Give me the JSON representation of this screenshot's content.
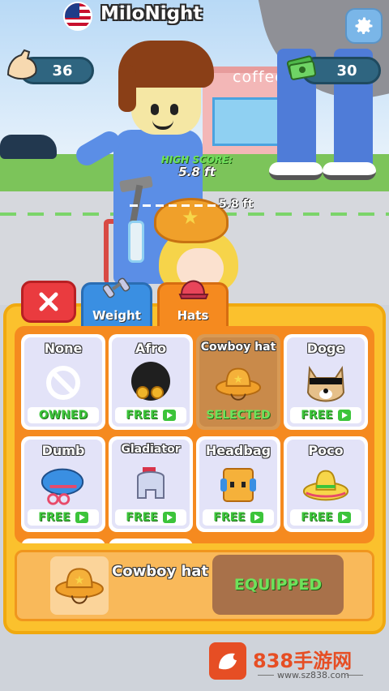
{
  "player": {
    "name": "MiloNight",
    "flag": "us-flag-icon"
  },
  "stats": {
    "strength": "36",
    "cash": "30"
  },
  "scene": {
    "sign": "coffee",
    "high_score_label": "HIGH SCORE:",
    "high_score_value": "5.8 ft",
    "height_marker": "5.8 ft"
  },
  "tabs": [
    {
      "id": "close",
      "icon": "close-icon"
    },
    {
      "id": "weight",
      "label": "Weight",
      "icon": "dumbbell-icon"
    },
    {
      "id": "hats",
      "label": "Hats",
      "icon": "cap-icon",
      "active": true
    }
  ],
  "items": [
    {
      "name": "None",
      "status": "OWNED",
      "icon": "none-icon"
    },
    {
      "name": "Afro",
      "status": "FREE",
      "icon": "afro-icon",
      "ad": true
    },
    {
      "name": "Cowboy hat",
      "status": "SELECTED",
      "icon": "cowboy-hat-icon",
      "selected": true
    },
    {
      "name": "Doge",
      "status": "FREE",
      "icon": "doge-icon",
      "ad": true
    },
    {
      "name": "Dumb",
      "status": "FREE",
      "icon": "dumb-icon",
      "ad": true
    },
    {
      "name": "Gladiator",
      "status": "FREE",
      "icon": "gladiator-icon",
      "ad": true
    },
    {
      "name": "Headbag",
      "status": "FREE",
      "icon": "headbag-icon",
      "ad": true
    },
    {
      "name": "Poco",
      "status": "FREE",
      "icon": "sombrero-icon",
      "ad": true
    }
  ],
  "preview": {
    "name": "Cowboy hat",
    "button": "EQUIPPED"
  },
  "watermark": {
    "text": "838手游网",
    "url": "www.sz838.com"
  },
  "colors": {
    "panel": "#fbc12d",
    "grid": "#f58a1f",
    "free_green": "#3cc43a",
    "close_red": "#ea3b3f",
    "weight_blue": "#3a8fe2"
  }
}
